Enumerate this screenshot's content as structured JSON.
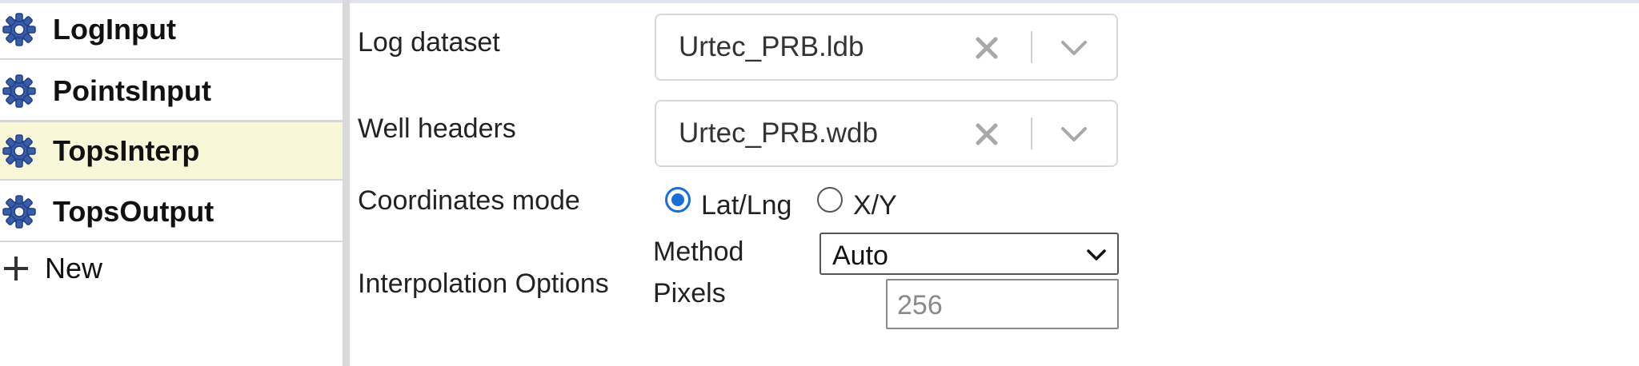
{
  "sidebar": {
    "items": [
      {
        "label": "LogInput"
      },
      {
        "label": "PointsInput"
      },
      {
        "label": "TopsInterp"
      },
      {
        "label": "TopsOutput"
      }
    ],
    "new_label": "New"
  },
  "form": {
    "log_dataset": {
      "label": "Log dataset",
      "value": "Urtec_PRB.ldb"
    },
    "well_headers": {
      "label": "Well headers",
      "value": "Urtec_PRB.wdb"
    },
    "coordinates_mode": {
      "label": "Coordinates mode",
      "options": [
        {
          "label": "Lat/Lng",
          "selected": true
        },
        {
          "label": "X/Y",
          "selected": false
        }
      ]
    },
    "interpolation": {
      "label": "Interpolation Options",
      "method_label": "Method",
      "method_value": "Auto",
      "pixels_label": "Pixels",
      "pixels_placeholder": "256"
    }
  },
  "colors": {
    "accent": "#1a6fd6",
    "active_row": "#f8f8d8",
    "gear": "#3a5da8"
  }
}
